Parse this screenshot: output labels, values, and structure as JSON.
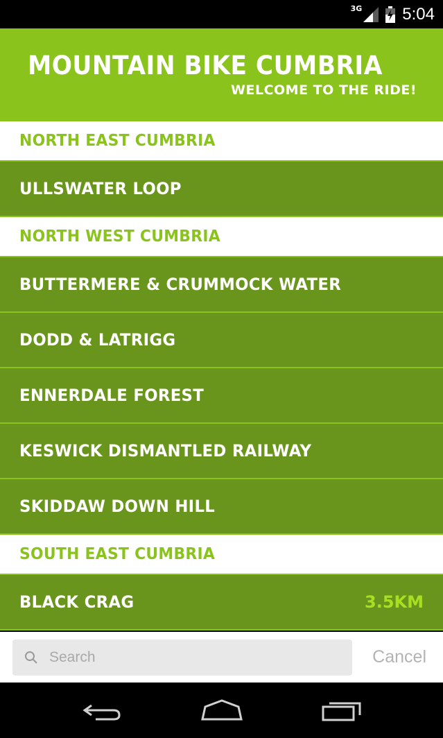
{
  "status_bar": {
    "network": "3G",
    "time": "5:04"
  },
  "header": {
    "title": "MOUNTAIN BIKE CUMBRIA",
    "subtitle": "WELCOME TO THE RIDE!"
  },
  "sections": [
    {
      "title": "NORTH EAST CUMBRIA",
      "routes": [
        {
          "name": "ULLSWATER LOOP",
          "distance": ""
        }
      ]
    },
    {
      "title": "NORTH WEST CUMBRIA",
      "routes": [
        {
          "name": "BUTTERMERE & CRUMMOCK WATER",
          "distance": ""
        },
        {
          "name": "DODD & LATRIGG",
          "distance": ""
        },
        {
          "name": "ENNERDALE FOREST",
          "distance": ""
        },
        {
          "name": "KESWICK DISMANTLED RAILWAY",
          "distance": ""
        },
        {
          "name": "SKIDDAW DOWN HILL",
          "distance": ""
        }
      ]
    },
    {
      "title": "SOUTH EAST CUMBRIA",
      "routes": [
        {
          "name": "BLACK CRAG",
          "distance": "3.5KM"
        }
      ]
    }
  ],
  "search": {
    "placeholder": "Search",
    "cancel_label": "Cancel"
  },
  "colors": {
    "brand_green": "#8ac31b",
    "row_green": "#6a951c",
    "distance_green": "#a8e021"
  },
  "icons": {
    "search": "search-icon",
    "back": "back-icon",
    "home": "home-icon",
    "recents": "recents-icon",
    "signal": "signal-icon",
    "battery": "battery-icon"
  }
}
